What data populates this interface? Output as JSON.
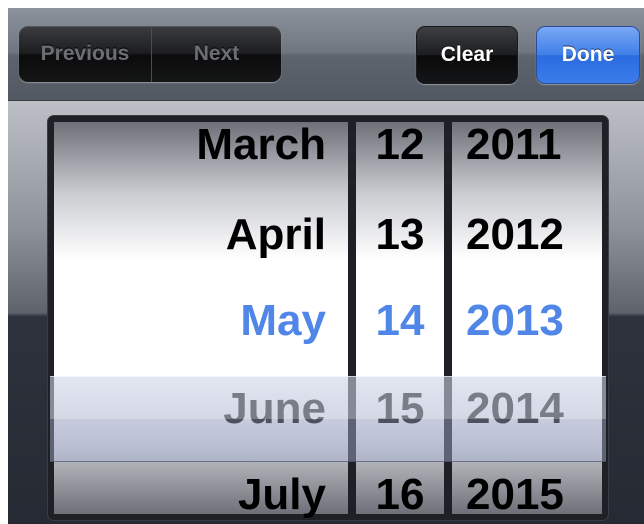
{
  "toolbar": {
    "previous_label": "Previous",
    "next_label": "Next",
    "clear_label": "Clear",
    "done_label": "Done"
  },
  "picker": {
    "months": [
      "March",
      "April",
      "May",
      "June",
      "July"
    ],
    "days": [
      "12",
      "13",
      "14",
      "15",
      "16"
    ],
    "years": [
      "2011",
      "2012",
      "2013",
      "2014",
      "2015"
    ],
    "selected": {
      "month": "May",
      "day": "14",
      "year": "2013"
    }
  },
  "colors": {
    "done_blue": "#3b7cea",
    "selected_text": "#4f86e8"
  }
}
